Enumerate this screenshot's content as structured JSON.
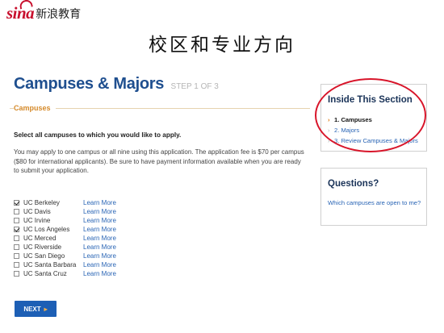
{
  "logo": {
    "mark": "sina",
    "text": "新浪教育"
  },
  "slide_title": "校区和专业方向",
  "page": {
    "title": "Campuses & Majors",
    "step": "STEP 1 OF 3"
  },
  "section_label": "Campuses",
  "instructions": "Select all campuses to which you would like to apply.",
  "body_text": "You may apply to one campus or all nine using this application. The application fee is $70 per campus ($80 for international applicants). Be sure to have payment information available when you are ready to submit your application.",
  "campuses": [
    {
      "name": "UC Berkeley",
      "checked": true,
      "link": "Learn More"
    },
    {
      "name": "UC Davis",
      "checked": false,
      "link": "Learn More"
    },
    {
      "name": "UC Irvine",
      "checked": false,
      "link": "Learn More"
    },
    {
      "name": "UC Los Angeles",
      "checked": true,
      "link": "Learn More"
    },
    {
      "name": "UC Merced",
      "checked": false,
      "link": "Learn More"
    },
    {
      "name": "UC Riverside",
      "checked": false,
      "link": "Learn More"
    },
    {
      "name": "UC San Diego",
      "checked": false,
      "link": "Learn More"
    },
    {
      "name": "UC Santa Barbara",
      "checked": false,
      "link": "Learn More"
    },
    {
      "name": "UC Santa Cruz",
      "checked": false,
      "link": "Learn More"
    }
  ],
  "next_button": {
    "label": "NEXT",
    "icon": "chevron-right-icon"
  },
  "inside_section": {
    "title": "Inside This Section",
    "items": [
      {
        "label": "1. Campuses",
        "active": true
      },
      {
        "label": "2. Majors",
        "active": false
      },
      {
        "label": "3. Review Campuses & Majors",
        "active": false
      }
    ]
  },
  "questions": {
    "title": "Questions?",
    "link": "Which campuses are open to me?"
  },
  "colors": {
    "title_blue": "#1f4f8f",
    "link_blue": "#2a65b5",
    "accent_orange": "#d58a2a",
    "button_blue": "#1d5fb5",
    "annotation_red": "#d8152a",
    "logo_red": "#c8102e"
  }
}
